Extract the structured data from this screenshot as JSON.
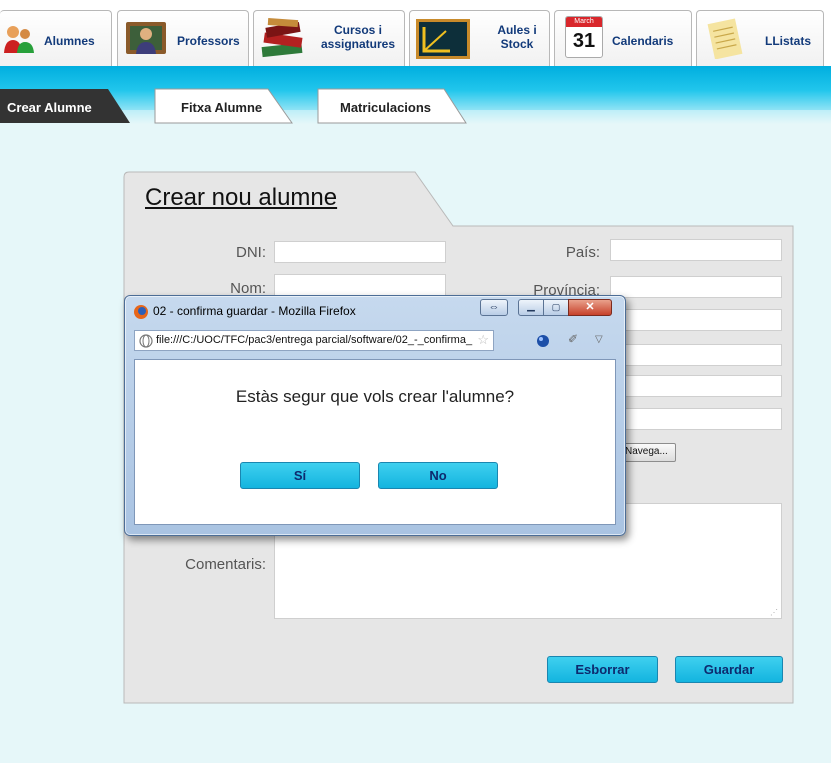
{
  "nav": {
    "tabs": [
      {
        "label": "Alumnes",
        "icon": "students-icon"
      },
      {
        "label": "Professors",
        "icon": "teacher-icon"
      },
      {
        "label": "Cursos i assignatures",
        "icon": "books-icon"
      },
      {
        "label": "Aules i Stock",
        "icon": "blackboard-icon"
      },
      {
        "label": "Calendaris",
        "icon": "calendar-icon",
        "calendar_day": "31",
        "calendar_month": "March"
      },
      {
        "label": "LListats",
        "icon": "notepad-icon"
      }
    ]
  },
  "subnav": {
    "tabs": [
      {
        "label": "Crear Alumne"
      },
      {
        "label": "Fitxa Alumne"
      },
      {
        "label": "Matriculacions"
      }
    ]
  },
  "form": {
    "title": "Crear nou alumne",
    "labels": {
      "dni": "DNI:",
      "nom": "Nom:",
      "pais": "País:",
      "provincia": "Província:",
      "comentaris": "Comentaris:"
    },
    "browse_button": "Navega...",
    "esborrar_button": "Esborrar",
    "guardar_button": "Guardar"
  },
  "dialog": {
    "title": "02 - confirma guardar - Mozilla Firefox",
    "url": "file:///C:/UOC/TFC/pac3/entrega parcial/software/02_-_confirma_",
    "message": "Estàs segur que vols crear l'alumne?",
    "yes_button": "Sí",
    "no_button": "No"
  },
  "colors": {
    "accent_blue": "#13b4df",
    "nav_text": "#123a7a"
  }
}
